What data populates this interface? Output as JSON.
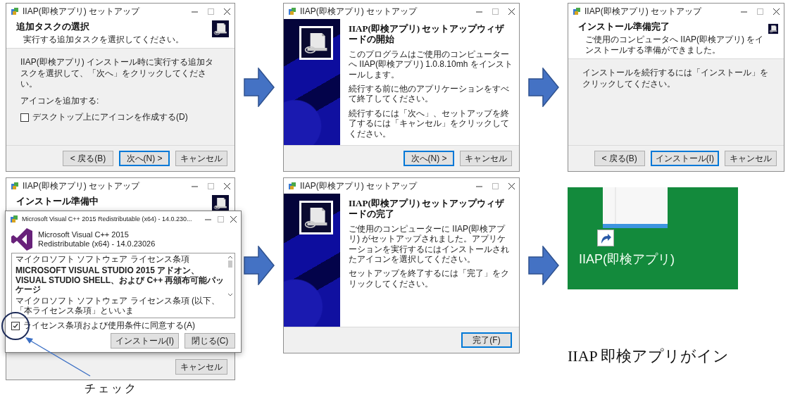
{
  "rows": [
    {
      "items": [
        {
          "kind": "page",
          "title": "IIAP(即検アプリ) セットアップ",
          "heading": "追加タスクの選択",
          "subheading": "実行する追加タスクを選択してください。",
          "body": [
            {
              "kind": "text",
              "text": "IIAP(即検アプリ) インストール時に実行する追加タスクを選択して、「次へ」をクリックしてください。"
            },
            {
              "kind": "label",
              "text": "アイコンを追加する:"
            },
            {
              "kind": "checkbox",
              "text": "デスクトップ上にアイコンを作成する(D)",
              "checked": false
            }
          ],
          "buttons": [
            {
              "label": "< 戻る(B)",
              "selected": false
            },
            {
              "label": "次へ(N) >",
              "selected": true
            },
            {
              "label": "キャンセル",
              "selected": false
            }
          ]
        },
        {
          "kind": "arrow"
        },
        {
          "kind": "welcome",
          "title": "IIAP(即検アプリ) セットアップ",
          "heading": "IIAP(即検アプリ) セットアップウィザードの開始",
          "paragraphs": [
            "このプログラムはご使用のコンピューターへ IIAP(即検アプリ) 1.0.8.10mh をインストールします。",
            "続行する前に他のアプリケーションをすべて終了してください。",
            "続行するには「次へ」、セットアップを終了するには「キャンセル」をクリックしてください。"
          ],
          "buttons": [
            {
              "label": "次へ(N) >",
              "selected": true
            },
            {
              "label": "キャンセル",
              "selected": false
            }
          ]
        },
        {
          "kind": "arrow"
        },
        {
          "kind": "page",
          "title": "IIAP(即検アプリ) セットアップ",
          "heading": "インストール準備完了",
          "subheading": "ご使用のコンピュータへ IIAP(即検アプリ) をインストールする準備ができました。",
          "body": [
            {
              "kind": "text",
              "text": "インストールを続行するには「インストール」をクリックしてください。"
            }
          ],
          "buttons": [
            {
              "label": "< 戻る(B)",
              "selected": false
            },
            {
              "label": "インストール(I)",
              "selected": true
            },
            {
              "label": "キャンセル",
              "selected": false
            }
          ]
        }
      ]
    },
    {
      "items": [
        {
          "kind": "page",
          "title": "IIAP(即検アプリ) セットアップ",
          "heading": "インストール準備中",
          "buttons": [
            {
              "label": "キャンセル",
              "selected": false
            }
          ],
          "dialog": {
            "title": "Microsoft Visual C++ 2015 Redistributable (x64) - 14.0.230...",
            "product": [
              "Microsoft Visual C++ 2015",
              "Redistributable (x64) - 14.0.23026"
            ],
            "license": [
              {
                "kind": "heading",
                "text": "マイクロソフト ソフトウェア ライセンス条項"
              },
              {
                "kind": "bold",
                "text": "MICROSOFT VISUAL STUDIO 2015 アドオン、VISUAL STUDIO SHELL、および C++ 再頒布可能パッケージ"
              },
              {
                "kind": "text",
                "text": "マイクロソフト ソフトウェア ライセンス条項 (以下、「本ライセンス条項」といいま"
              }
            ],
            "agree": {
              "label": "ライセンス条項および使用条件に同意する(A)",
              "checked": true
            },
            "buttons": [
              {
                "label": "インストール(I)",
                "selected": false
              },
              {
                "label": "閉じる(C)",
                "selected": false
              }
            ]
          },
          "callout": "チェック"
        },
        {
          "kind": "arrow"
        },
        {
          "kind": "welcome",
          "title": "IIAP(即検アプリ) セットアップ",
          "heading": "IIAP(即検アプリ) セットアップウィザードの完了",
          "paragraphs": [
            "ご使用のコンピューターに IIAP(即検アプリ) がセットアップされました。アプリケーションを実行するにはインストールされたアイコンを選択してください。",
            "セットアップを終了するには「完了」をクリックしてください。"
          ],
          "buttons": [
            {
              "label": "完了(F)",
              "selected": true
            }
          ]
        },
        {
          "kind": "arrow"
        },
        {
          "kind": "desktop",
          "icon_label": "IIAP(即検アプリ)",
          "caption": "IIAP 即検アプリがイン"
        }
      ]
    }
  ]
}
